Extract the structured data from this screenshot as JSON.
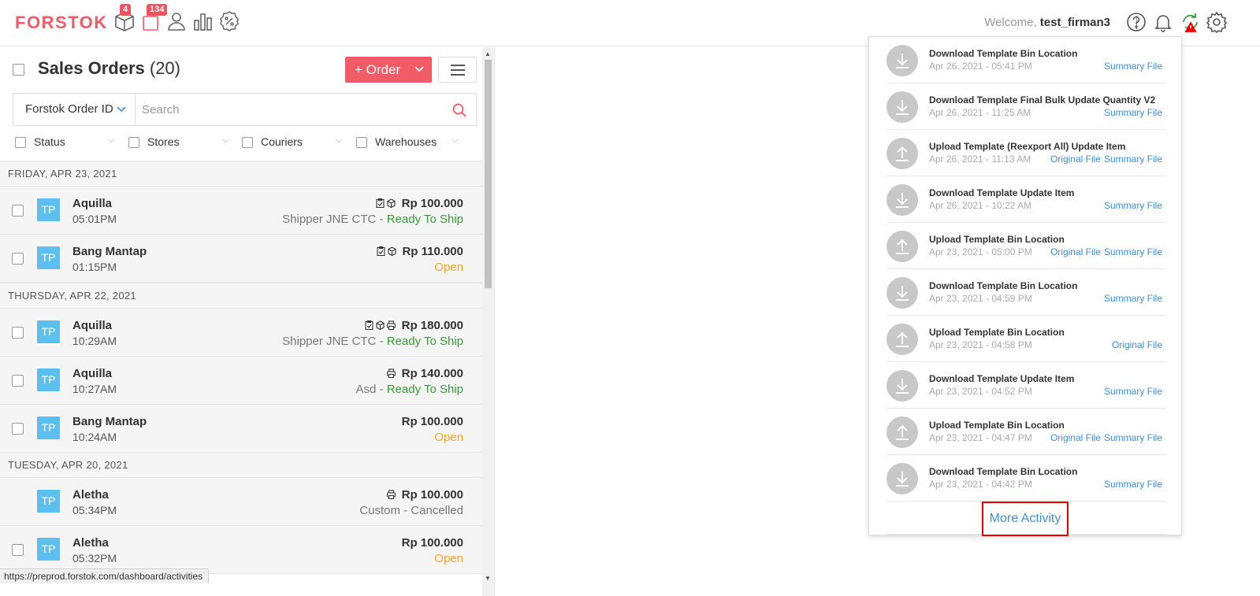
{
  "topbar": {
    "logo": "FORSTOK",
    "badge_products": "4",
    "badge_orders": "134",
    "welcome_prefix": "Welcome,",
    "username": "test_firman3"
  },
  "icons": {
    "nav": [
      "box-icon",
      "shopping-bag-icon",
      "user-icon",
      "bar-chart-icon",
      "promo-percent-icon"
    ],
    "right": [
      "help-icon",
      "bell-icon",
      "sync-warning-icon",
      "gear-icon"
    ]
  },
  "colors": {
    "brand": "#f25c66",
    "badge": "#f0535d",
    "link": "#3f8fd8",
    "avatar": "#5bc0f0",
    "ready": "#3a9a3a",
    "open": "#f5a623",
    "highlight": "#e00000"
  },
  "orders_panel": {
    "title": "Sales Orders",
    "count": "(20)",
    "order_button": "+ Order",
    "search_field": "Forstok Order ID",
    "search_placeholder": "Search",
    "filters": [
      "Status",
      "Stores",
      "Couriers",
      "Warehouses"
    ]
  },
  "groups": [
    {
      "date": "FRIDAY, APR 23, 2021",
      "orders": [
        {
          "avatar": "TP",
          "customer": "Aquilla",
          "time": "05:01PM",
          "amount": "Rp 100.000",
          "shipper": "Shipper JNE CTC - ",
          "status": "Ready To Ship",
          "status_type": "green",
          "icons": "clip-box"
        },
        {
          "avatar": "TP",
          "customer": "Bang Mantap",
          "time": "01:15PM",
          "amount": "Rp 110.000",
          "shipper": "",
          "status": "Open",
          "status_type": "orange",
          "icons": "clip-box"
        }
      ]
    },
    {
      "date": "THURSDAY, APR 22, 2021",
      "orders": [
        {
          "avatar": "TP",
          "customer": "Aquilla",
          "time": "10:29AM",
          "amount": "Rp 180.000",
          "shipper": "Shipper JNE CTC - ",
          "status": "Ready To Ship",
          "status_type": "green",
          "icons": "clip-box-print"
        },
        {
          "avatar": "TP",
          "customer": "Aquilla",
          "time": "10:27AM",
          "amount": "Rp 140.000",
          "shipper": "Asd - ",
          "status": "Ready To Ship",
          "status_type": "green",
          "icons": "print"
        },
        {
          "avatar": "TP",
          "customer": "Bang Mantap",
          "time": "10:24AM",
          "amount": "Rp 100.000",
          "shipper": "",
          "status": "Open",
          "status_type": "orange",
          "icons": ""
        }
      ]
    },
    {
      "date": "TUESDAY, APR 20, 2021",
      "orders": [
        {
          "avatar": "TP",
          "customer": "Aletha",
          "time": "05:34PM",
          "amount": "Rp 100.000",
          "shipper": "Custom - ",
          "status": "Cancelled",
          "status_type": "gray",
          "icons": "print"
        },
        {
          "avatar": "TP",
          "customer": "Aletha",
          "time": "05:32PM",
          "amount": "Rp 100.000",
          "shipper": "",
          "status": "Open",
          "status_type": "orange",
          "icons": ""
        }
      ]
    }
  ],
  "status_url": "https://preprod.forstok.com/dashboard/activities",
  "activities": [
    {
      "type": "download",
      "title": "Download Template Bin Location",
      "date": "Apr 26, 2021 - 05:41 PM",
      "links": [
        "Summary File"
      ]
    },
    {
      "type": "download",
      "title": "Download Template Final Bulk Update Quantity V2",
      "date": "Apr 26, 2021 - 11:25 AM",
      "links": [
        "Summary File"
      ]
    },
    {
      "type": "upload",
      "title": "Upload Template (Reexport All) Update Item",
      "date": "Apr 26, 2021 - 11:13 AM",
      "links": [
        "Original File",
        "Summary File"
      ]
    },
    {
      "type": "download",
      "title": "Download Template Update Item",
      "date": "Apr 26, 2021 - 10:22 AM",
      "links": [
        "Summary File"
      ]
    },
    {
      "type": "upload",
      "title": "Upload Template Bin Location",
      "date": "Apr 23, 2021 - 05:00 PM",
      "links": [
        "Original File",
        "Summary File"
      ]
    },
    {
      "type": "download",
      "title": "Download Template Bin Location",
      "date": "Apr 23, 2021 - 04:59 PM",
      "links": [
        "Summary File"
      ]
    },
    {
      "type": "upload",
      "title": "Upload Template Bin Location",
      "date": "Apr 23, 2021 - 04:58 PM",
      "links": [
        "Original File"
      ]
    },
    {
      "type": "download",
      "title": "Download Template Update Item",
      "date": "Apr 23, 2021 - 04:52 PM",
      "links": [
        "Summary File"
      ]
    },
    {
      "type": "upload",
      "title": "Upload Template Bin Location",
      "date": "Apr 23, 2021 - 04:47 PM",
      "links": [
        "Original File",
        "Summary File"
      ]
    },
    {
      "type": "download",
      "title": "Download Template Bin Location",
      "date": "Apr 23, 2021 - 04:42 PM",
      "links": [
        "Summary File"
      ]
    }
  ],
  "more_activity": "More Activity"
}
